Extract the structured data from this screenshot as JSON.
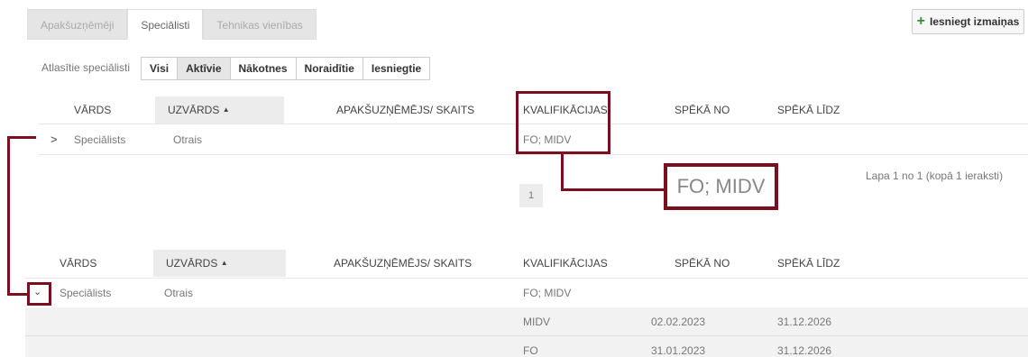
{
  "tabs": [
    {
      "label": "Apakšuzņēmēji",
      "active": false
    },
    {
      "label": "Speciālisti",
      "active": true
    },
    {
      "label": "Tehnikas vienības",
      "active": false
    }
  ],
  "submit_label": "Iesniegt izmaiņas",
  "filter": {
    "label": "Atlasītie speciālisti",
    "buttons": [
      "Visi",
      "Aktīvie",
      "Nākotnes",
      "Noraidītie",
      "Iesniegtie"
    ],
    "active": "Aktīvie"
  },
  "columns": {
    "name": "VĀRDS",
    "surname": "UZVĀRDS",
    "subcontractor": "APAKŠUZŅĒMĒJS/ SKAITS",
    "qualifications": "KVALIFIKĀCIJAS",
    "valid_from": "SPĒKĀ NO",
    "valid_to": "SPĒKĀ LĪDZ"
  },
  "row": {
    "name": "Speciālists",
    "surname": "Otrais",
    "qualifications": "FO; MIDV"
  },
  "pager": {
    "page": "1",
    "info": "Lapa 1 no 1 (kopā 1 ieraksti)"
  },
  "callout_text": "FO; MIDV",
  "subrows": [
    {
      "qualification": "MIDV",
      "from": "02.02.2023",
      "to": "31.12.2026"
    },
    {
      "qualification": "FO",
      "from": "31.01.2023",
      "to": "31.12.2026"
    }
  ],
  "sort_icon": "caret-up-icon",
  "accent_color": "#7b0e1f"
}
